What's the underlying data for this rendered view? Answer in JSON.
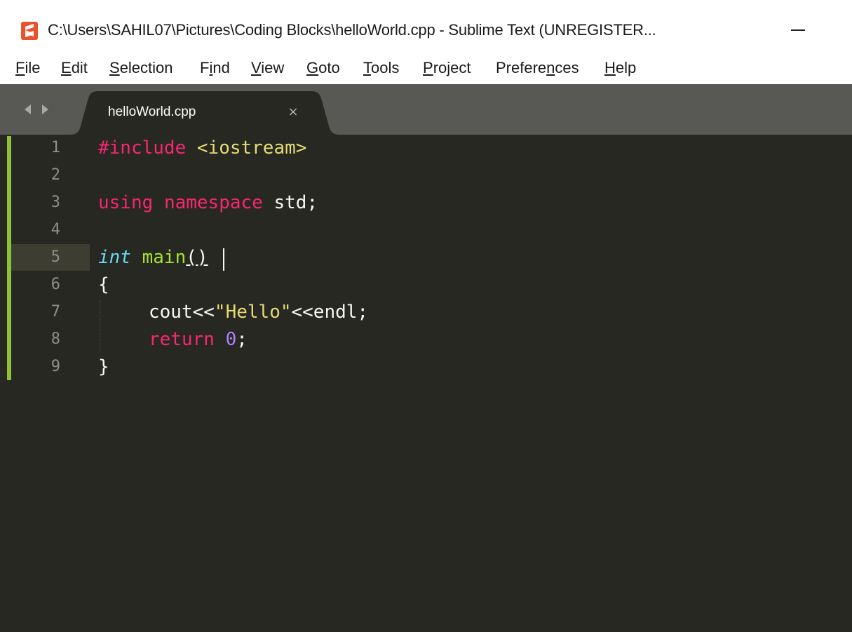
{
  "window": {
    "title": "C:\\Users\\SAHIL07\\Pictures\\Coding Blocks\\helloWorld.cpp - Sublime Text (UNREGISTER..."
  },
  "menu": [
    {
      "pre": "",
      "acc": "F",
      "post": "ile"
    },
    {
      "pre": "",
      "acc": "E",
      "post": "dit"
    },
    {
      "pre": "",
      "acc": "S",
      "post": "election"
    },
    {
      "pre": "F",
      "acc": "i",
      "post": "nd"
    },
    {
      "pre": "",
      "acc": "V",
      "post": "iew"
    },
    {
      "pre": "",
      "acc": "G",
      "post": "oto"
    },
    {
      "pre": "",
      "acc": "T",
      "post": "ools"
    },
    {
      "pre": "",
      "acc": "P",
      "post": "roject"
    },
    {
      "pre": "Prefere",
      "acc": "n",
      "post": "ces"
    },
    {
      "pre": "",
      "acc": "H",
      "post": "elp"
    }
  ],
  "tab": {
    "label": "helloWorld.cpp",
    "close_glyph": "×"
  },
  "editor": {
    "line_numbers": [
      "1",
      "2",
      "3",
      "4",
      "5",
      "6",
      "7",
      "8",
      "9"
    ],
    "current_line": 5,
    "code": {
      "l1_directive": "#include",
      "l1_header": "<iostream>",
      "l3_using": "using",
      "l3_namespace": "namespace",
      "l3_rest": "std;",
      "l5_type": "int",
      "l5_fn": "main",
      "l5_parens": "()",
      "l6_brace": "{",
      "l7_cout": "cout<<",
      "l7_str": "\"Hello\"",
      "l7_rest": "<<endl;",
      "l8_return": "return",
      "l8_num": "0",
      "l8_semi": ";",
      "l9_brace": "}"
    }
  },
  "colors": {
    "editor_bg": "#272822",
    "tabstrip_bg": "#585855",
    "keyword": "#f92672",
    "string": "#e6db74",
    "type": "#66d9ef",
    "function": "#a6e22e",
    "number": "#ae81ff",
    "modified_marker": "#8dc236"
  },
  "icons": {
    "app": "sublime-text-logo-icon",
    "nav": "left-right-arrows-icon",
    "close": "close-icon",
    "minimize": "minimize-icon"
  }
}
